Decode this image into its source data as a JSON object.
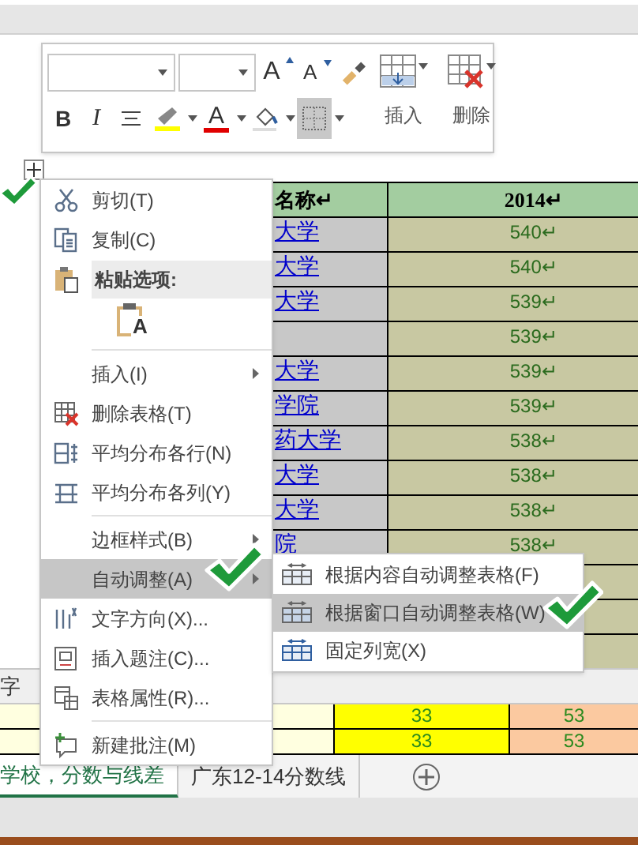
{
  "toolbar": {
    "top_buttons": [
      {
        "kind": "grow_font",
        "glyph": "A"
      },
      {
        "kind": "shrink_font",
        "glyph": "A"
      },
      {
        "kind": "format_painter"
      }
    ],
    "format_buttons": [
      {
        "kind": "bold",
        "glyph": "B",
        "pressed": false
      },
      {
        "kind": "italic",
        "glyph": "I",
        "pressed": false
      },
      {
        "kind": "align",
        "pressed": false
      },
      {
        "kind": "highlight",
        "pressed": false
      },
      {
        "kind": "font_color",
        "glyph": "A",
        "pressed": false
      },
      {
        "kind": "shading",
        "pressed": false
      },
      {
        "kind": "borders",
        "pressed": true
      }
    ],
    "insert_label": "插入",
    "delete_label": "删除"
  },
  "table": {
    "columns": [
      {
        "label": "名称↵"
      },
      {
        "label": "2014↵"
      }
    ],
    "rows": [
      {
        "name": "大学",
        "value": "540↵"
      },
      {
        "name": "大学",
        "value": "540↵"
      },
      {
        "name": "大学",
        "value": "539↵"
      },
      {
        "name": "",
        "value": "539↵"
      },
      {
        "name": "大学",
        "value": "539↵"
      },
      {
        "name": "学院",
        "value": "539↵"
      },
      {
        "name": "药大学",
        "value": "538↵"
      },
      {
        "name": "大学",
        "value": "538↵"
      },
      {
        "name": "大学",
        "value": "538↵"
      },
      {
        "name": "院",
        "value": "538↵"
      }
    ]
  },
  "band_label": "字",
  "yellow_rows": [
    {
      "column_2": "33",
      "column_3": "53"
    },
    {
      "column_2": "33",
      "column_3": "53"
    }
  ],
  "sheet_tabs": [
    {
      "label": "学校，分数与线差",
      "selected": true
    },
    {
      "label": "广东12-14分数线",
      "selected": false
    }
  ],
  "context_menu": {
    "items": [
      {
        "kind": "item",
        "label": "剪切(T)",
        "selected": false,
        "has_submenu": false
      },
      {
        "kind": "item",
        "label": "复制(C)",
        "selected": false,
        "has_submenu": false
      },
      {
        "kind": "heading",
        "label": "粘贴选项:",
        "selected": false
      },
      {
        "kind": "paste_option",
        "glyph": "A",
        "selected": false
      },
      {
        "kind": "separator"
      },
      {
        "kind": "item",
        "label": "插入(I)",
        "selected": false,
        "has_submenu": true
      },
      {
        "kind": "item",
        "label": "删除表格(T)",
        "selected": false,
        "has_submenu": false
      },
      {
        "kind": "item",
        "label": "平均分布各行(N)",
        "selected": false,
        "has_submenu": false
      },
      {
        "kind": "item",
        "label": "平均分布各列(Y)",
        "selected": false,
        "has_submenu": false
      },
      {
        "kind": "separator"
      },
      {
        "kind": "item",
        "label": "边框样式(B)",
        "selected": false,
        "has_submenu": true
      },
      {
        "kind": "item",
        "label": "自动调整(A)",
        "selected": true,
        "has_submenu": true
      },
      {
        "kind": "item",
        "label": "文字方向(X)...",
        "selected": false,
        "has_submenu": false
      },
      {
        "kind": "item",
        "label": "插入题注(C)...",
        "selected": false,
        "has_submenu": false
      },
      {
        "kind": "item",
        "label": "表格属性(R)...",
        "selected": false,
        "has_submenu": false
      },
      {
        "kind": "separator"
      },
      {
        "kind": "item",
        "label": "新建批注(M)",
        "selected": false,
        "has_submenu": false
      }
    ]
  },
  "submenu": {
    "items": [
      {
        "label": "根据内容自动调整表格(F)",
        "selected": false
      },
      {
        "label": "根据窗口自动调整表格(W)",
        "selected": true
      },
      {
        "label": "固定列宽(X)",
        "selected": false
      }
    ]
  }
}
